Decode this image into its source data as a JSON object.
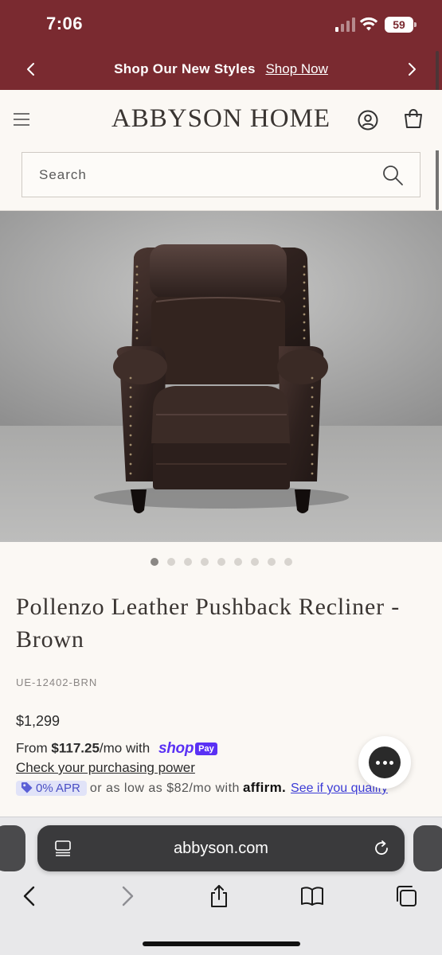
{
  "status_bar": {
    "time": "7:06",
    "battery": "59"
  },
  "promo": {
    "title": "Shop Our New Styles",
    "link": "Shop Now"
  },
  "header": {
    "logo": "ABBYSON HOME"
  },
  "search": {
    "placeholder": "Search"
  },
  "gallery": {
    "image_count": 9,
    "active_index": 0
  },
  "product": {
    "title": "Pollenzo Leather Pushback Recliner - Brown",
    "sku": "UE-12402-BRN",
    "price": "$1,299"
  },
  "shop_pay": {
    "prefix": "From",
    "amount": "$117.25",
    "suffix": "/mo with",
    "brand": "shop",
    "brand_badge": "Pay",
    "check_link": "Check your purchasing power"
  },
  "affirm": {
    "apr": "0% APR",
    "text": "or as low as $82/mo with",
    "brand": "affirm.",
    "link": "See if you qualify"
  },
  "browser": {
    "url": "abbyson.com"
  },
  "colors": {
    "banner": "#7a2a30",
    "shop_pay": "#5a31f4",
    "affirm_link": "#3b3bd6",
    "background": "#fbf8f4"
  }
}
